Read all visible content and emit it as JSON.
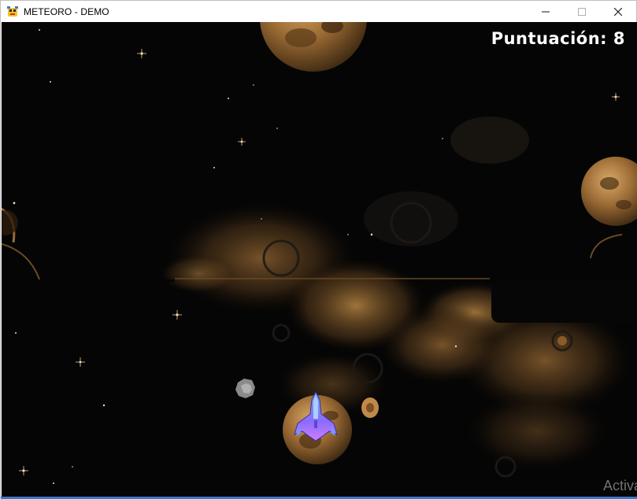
{
  "window": {
    "title": "METEORO - DEMO",
    "icons": {
      "app": "python-snake-icon",
      "minimize": "minimize-icon",
      "maximize": "maximize-icon",
      "close": "close-icon"
    }
  },
  "game": {
    "score_text": "Puntuación: 8",
    "watermark_text": "Activa",
    "colors": {
      "space": "#050505",
      "planet": "#b88a4a",
      "nebula": "#6b4a26",
      "ship": "#8a7cff",
      "star": "#ffd9a0"
    }
  }
}
